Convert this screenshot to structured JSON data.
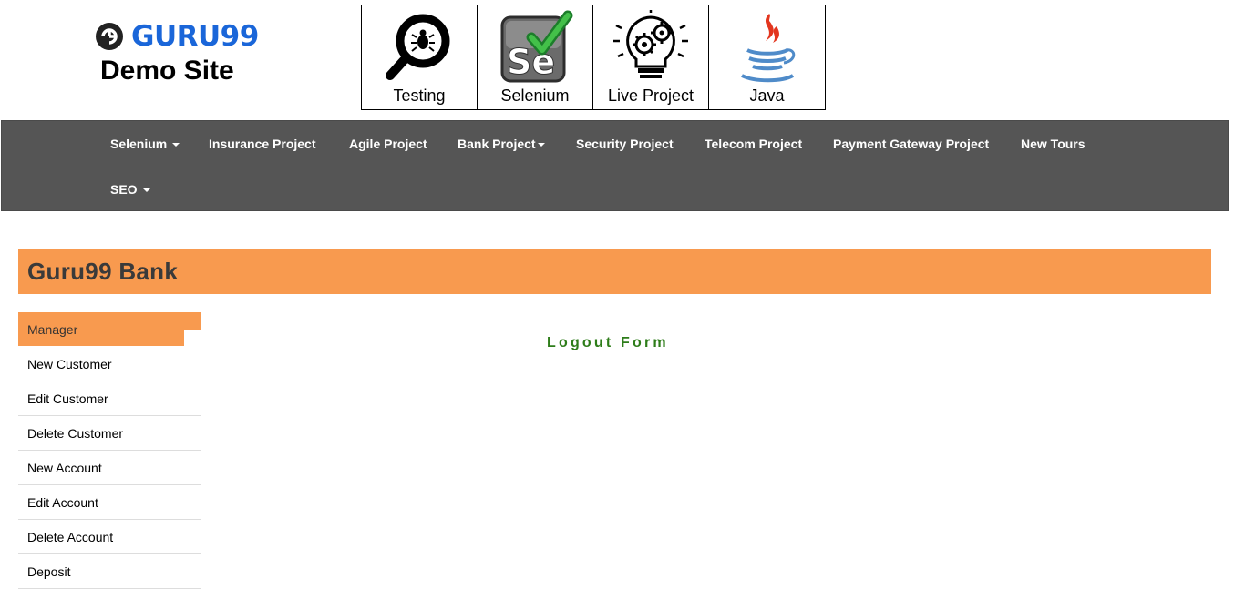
{
  "header": {
    "logo_text": "GURU99",
    "subtitle": "Demo Site",
    "logo_color": "#1a66d9",
    "tiles": [
      {
        "label": "Testing",
        "icon": "magnifier-bug-icon"
      },
      {
        "label": "Selenium",
        "icon": "selenium-icon"
      },
      {
        "label": "Live Project",
        "icon": "lightbulb-gears-icon"
      },
      {
        "label": "Java",
        "icon": "java-cup-icon"
      }
    ]
  },
  "nav": {
    "background": "#555555",
    "items": [
      {
        "label": "Selenium",
        "dropdown": true
      },
      {
        "label": "Insurance Project",
        "dropdown": false
      },
      {
        "label": "Agile Project",
        "dropdown": false
      },
      {
        "label": "Bank Project",
        "dropdown": true
      },
      {
        "label": "Security Project",
        "dropdown": false
      },
      {
        "label": "Telecom Project",
        "dropdown": false
      },
      {
        "label": "Payment Gateway Project",
        "dropdown": false
      },
      {
        "label": "New Tours",
        "dropdown": false
      },
      {
        "label": "SEO",
        "dropdown": true
      }
    ]
  },
  "banner": {
    "title": "Guru99 Bank",
    "color": "#f89a4f"
  },
  "sidebar": {
    "header": "Manager",
    "items": [
      {
        "label": "New Customer"
      },
      {
        "label": "Edit Customer"
      },
      {
        "label": "Delete Customer"
      },
      {
        "label": "New Account"
      },
      {
        "label": "Edit Account"
      },
      {
        "label": "Delete Account"
      },
      {
        "label": "Deposit"
      }
    ]
  },
  "main": {
    "form_title": "Logout Form",
    "form_title_color": "#2e7d1a"
  }
}
